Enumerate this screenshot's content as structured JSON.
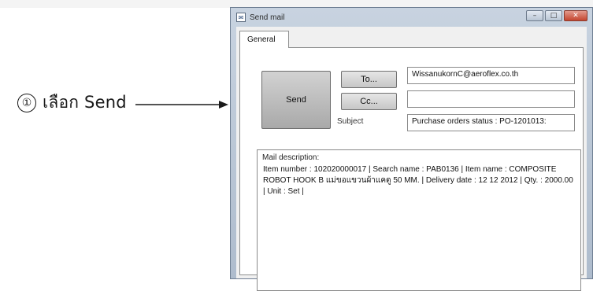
{
  "annotation": {
    "step_number": "①",
    "text": "เลือก Send"
  },
  "window": {
    "title": "Send mail",
    "controls": {
      "minimize": "–",
      "maximize": "□",
      "close": "✕"
    }
  },
  "tabs": [
    {
      "label": "General"
    }
  ],
  "form": {
    "send_label": "Send",
    "to_label": "To...",
    "cc_label": "Cc...",
    "subject_label": "Subject",
    "to_value": "WissanukornC@aeroflex.co.th",
    "cc_value": "",
    "subject_value": "Purchase orders status : PO-1201013:",
    "description_label": "Mail description:",
    "description_text": "Item number : 102020000017 | Search name : PAB0136 | Item name : COMPOSITE ROBOT HOOK B แม่ขอแขวนผ้าแคตู 50 MM. | Delivery date : 12 12 2012 | Qty. : 2000.00 | Unit : Set |"
  }
}
